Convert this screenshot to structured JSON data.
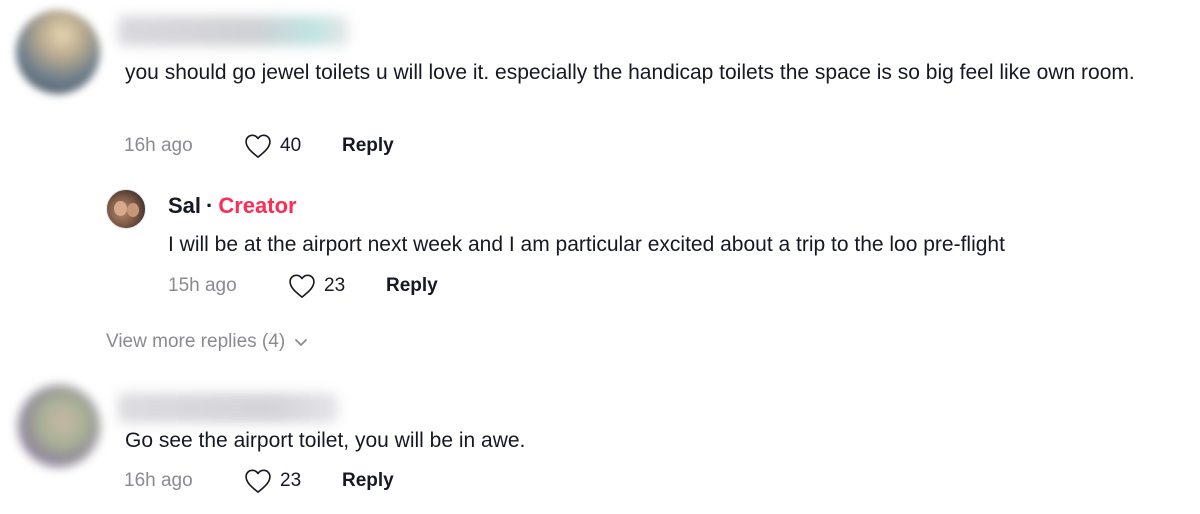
{
  "comments": [
    {
      "text": "you should go jewel toilets u will love it. especially the handicap toilets the space is so big feel like own room.",
      "time": "16h ago",
      "likes": "40",
      "reply_label": "Reply",
      "replies": [
        {
          "author": "Sal",
          "separator": "·",
          "badge": "Creator",
          "text": "I will be at the airport next week and I am particular excited about a trip to the loo pre-flight",
          "time": "15h ago",
          "likes": "23",
          "reply_label": "Reply"
        }
      ],
      "view_more_label": "View more replies (4)"
    },
    {
      "text": "Go see the airport toilet, you will be in awe.",
      "time": "16h ago",
      "likes": "23",
      "reply_label": "Reply"
    }
  ],
  "icons": {
    "like": "heart-outline-icon",
    "expand": "chevron-down-icon"
  },
  "colors": {
    "text": "#161823",
    "muted": "#8a8b91",
    "creator": "#fe2c55"
  }
}
